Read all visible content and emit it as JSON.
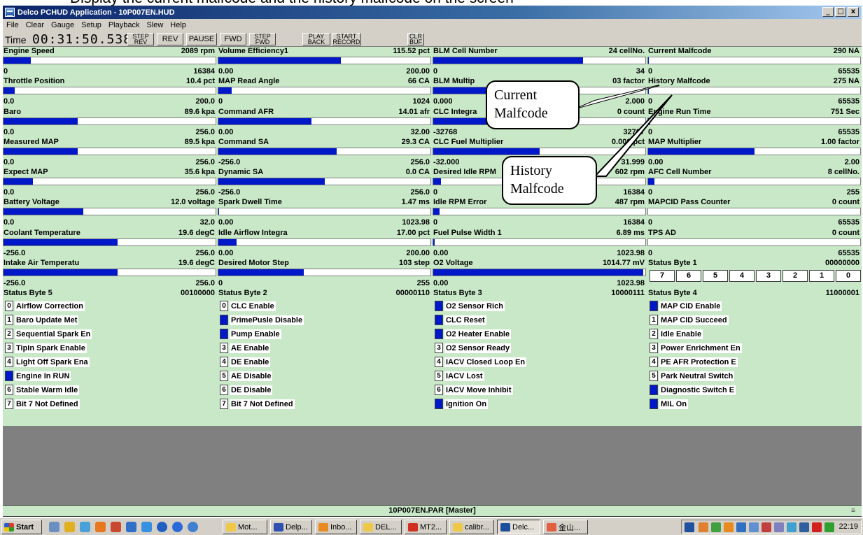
{
  "caption": "Display the current malfcode and the history malfcode on the screen",
  "window": {
    "title": "Delco PCHUD Application - 10P007EN.HUD",
    "buttons": [
      "_",
      "□",
      "x"
    ]
  },
  "menu": [
    "File",
    "Clear",
    "Gauge",
    "Setup",
    "Playback",
    "Slew",
    "Help"
  ],
  "toolbar": {
    "time_label": "Time",
    "time_value": "00:31:50.538",
    "step_rev": [
      "STEP",
      "REV"
    ],
    "rev": "REV",
    "pause": "PAUSE",
    "fwd": "FWD",
    "step_fwd": [
      "STEP",
      "FWD"
    ],
    "play_back": [
      "PLAY",
      "BACK"
    ],
    "start_record": [
      "START",
      "RECORD"
    ],
    "clr_buf": [
      "CLR",
      "BUF"
    ]
  },
  "gauges": [
    [
      {
        "name": "Engine Speed",
        "value": "2089 rpm",
        "min": "0",
        "max": "16384",
        "fill": 0.128
      },
      {
        "name": "Throttle Position",
        "value": "10.4 pct",
        "min": "0.0",
        "max": "200.0",
        "fill": 0.052
      },
      {
        "name": "Baro",
        "value": "89.6 kpa",
        "min": "0.0",
        "max": "256.0",
        "fill": 0.35
      },
      {
        "name": "Measured MAP",
        "value": "89.5 kpa",
        "min": "0.0",
        "max": "256.0",
        "fill": 0.35
      },
      {
        "name": "Expect MAP",
        "value": "35.6 kpa",
        "min": "0.0",
        "max": "256.0",
        "fill": 0.139
      },
      {
        "name": "Battery Voltage",
        "value": "12.0 voltage",
        "min": "0.0",
        "max": "32.0",
        "fill": 0.375
      },
      {
        "name": "Coolant Temperature",
        "value": "19.6 degC",
        "min": "-256.0",
        "max": "256.0",
        "fill": 0.538
      },
      {
        "name": "Intake Air Temperatu",
        "value": "19.6 degC",
        "min": "-256.0",
        "max": "256.0",
        "fill": 0.538
      }
    ],
    [
      {
        "name": "Volume Efficiency1",
        "value": "115.52 pct",
        "min": "0.00",
        "max": "200.00",
        "fill": 0.578
      },
      {
        "name": "MAP Read Angle",
        "value": "66 CA",
        "min": "0",
        "max": "1024",
        "fill": 0.064
      },
      {
        "name": "Command AFR",
        "value": "14.01 afr",
        "min": "0.00",
        "max": "32.00",
        "fill": 0.438
      },
      {
        "name": "Command SA",
        "value": "29.3 CA",
        "min": "-256.0",
        "max": "256.0",
        "fill": 0.557
      },
      {
        "name": "Dynamic SA",
        "value": "0.0 CA",
        "min": "-256.0",
        "max": "256.0",
        "fill": 0.5
      },
      {
        "name": "Spark Dwell Time",
        "value": "1.47 ms",
        "min": "0.00",
        "max": "1023.98",
        "fill": 0.0015
      },
      {
        "name": "Idle Airflow Integra",
        "value": "17.00 pct",
        "min": "0.00",
        "max": "200.00",
        "fill": 0.085
      },
      {
        "name": "Desired Motor Step",
        "value": "103 step",
        "min": "0",
        "max": "255",
        "fill": 0.404
      }
    ],
    [
      {
        "name": "BLM Cell Number",
        "value": "24 cellNo.",
        "min": "0",
        "max": "34",
        "fill": 0.706
      },
      {
        "name": "BLM Multip",
        "value": "03 factor",
        "min": "0.000",
        "max": "2.000",
        "fill": 0.5
      },
      {
        "name": "CLC Integra",
        "value": "0 count",
        "min": "-32768",
        "max": "32767",
        "fill": 0.5
      },
      {
        "name": "CLC Fuel Multiplier",
        "value": "0.000 pct",
        "min": "-32.000",
        "max": "31.999",
        "fill": 0.5
      },
      {
        "name": "Desired Idle RPM",
        "value": "602 rpm",
        "min": "0",
        "max": "16384",
        "fill": 0.037
      },
      {
        "name": "Idle RPM Error",
        "value": "487 rpm",
        "min": "0",
        "max": "16384",
        "fill": 0.03
      },
      {
        "name": "Fuel Pulse Width 1",
        "value": "6.89 ms",
        "min": "0.00",
        "max": "1023.98",
        "fill": 0.007
      },
      {
        "name": "O2 Voltage",
        "value": "1014.77 mV",
        "min": "0.00",
        "max": "1023.98",
        "fill": 0.991
      }
    ],
    [
      {
        "name": "Current Malfcode",
        "value": "290 NA",
        "min": "0",
        "max": "65535",
        "fill": 0.004
      },
      {
        "name": "History Malfcode",
        "value": "275 NA",
        "min": "0",
        "max": "65535",
        "fill": 0.004
      },
      {
        "name": "Engine Run Time",
        "value": "751 Sec",
        "min": "0",
        "max": "65535",
        "fill": 0.011
      },
      {
        "name": "MAP Multiplier",
        "value": "1.00 factor",
        "min": "0.00",
        "max": "2.00",
        "fill": 0.5
      },
      {
        "name": "AFC Cell Number",
        "value": "8 cellNo.",
        "min": "0",
        "max": "255",
        "fill": 0.031
      },
      {
        "name": "MAPCID Pass Counter",
        "value": "0 count",
        "min": "0",
        "max": "65535",
        "fill": 0
      },
      {
        "name": "TPS AD",
        "value": "0 count",
        "min": "0",
        "max": "65535",
        "fill": 0
      }
    ]
  ],
  "status_byte_1": {
    "label": "Status Byte 1",
    "value": "00000000",
    "bits": [
      "7",
      "6",
      "5",
      "4",
      "3",
      "2",
      "1",
      "0"
    ]
  },
  "status_blocks": [
    {
      "label": "Status Byte 5",
      "value": "00100000",
      "bits": [
        {
          "n": "0",
          "label": "Airflow Correction",
          "on": false
        },
        {
          "n": "1",
          "label": "Baro Update Met",
          "on": false
        },
        {
          "n": "2",
          "label": "Sequential Spark En",
          "on": false
        },
        {
          "n": "3",
          "label": "TipIn Spark Enable",
          "on": false
        },
        {
          "n": "4",
          "label": "Light Off Spark Ena",
          "on": false
        },
        {
          "n": "5",
          "label": "Engine In RUN",
          "on": true
        },
        {
          "n": "6",
          "label": "Stable Warm Idle",
          "on": false
        },
        {
          "n": "7",
          "label": "Bit 7 Not Defined",
          "on": false
        }
      ]
    },
    {
      "label": "Status Byte 2",
      "value": "00000110",
      "bits": [
        {
          "n": "0",
          "label": "CLC Enable",
          "on": false
        },
        {
          "n": "1",
          "label": "PrimePusle Disable",
          "on": true
        },
        {
          "n": "2",
          "label": "Pump Enable",
          "on": true
        },
        {
          "n": "3",
          "label": "AE Enable",
          "on": false
        },
        {
          "n": "4",
          "label": "DE Enable",
          "on": false
        },
        {
          "n": "5",
          "label": "AE Disable",
          "on": false
        },
        {
          "n": "6",
          "label": "DE Disable",
          "on": false
        },
        {
          "n": "7",
          "label": "Bit 7 Not Defined",
          "on": false
        }
      ]
    },
    {
      "label": "Status Byte 3",
      "value": "10000111",
      "bits": [
        {
          "n": "0",
          "label": "O2 Sensor Rich",
          "on": true
        },
        {
          "n": "1",
          "label": "CLC Reset",
          "on": true
        },
        {
          "n": "2",
          "label": "O2 Heater Enable",
          "on": true
        },
        {
          "n": "3",
          "label": "O2 Sensor Ready",
          "on": false
        },
        {
          "n": "4",
          "label": "IACV Closed Loop En",
          "on": false
        },
        {
          "n": "5",
          "label": "IACV Lost",
          "on": false
        },
        {
          "n": "6",
          "label": "IACV Move Inhibit",
          "on": false
        },
        {
          "n": "7",
          "label": "Ignition On",
          "on": true
        }
      ]
    },
    {
      "label": "Status Byte 4",
      "value": "11000001",
      "bits": [
        {
          "n": "0",
          "label": "MAP CID Enable",
          "on": true
        },
        {
          "n": "1",
          "label": "MAP CID Succeed",
          "on": false
        },
        {
          "n": "2",
          "label": "Idle Enable",
          "on": false
        },
        {
          "n": "3",
          "label": "Power Enrichment En",
          "on": false
        },
        {
          "n": "4",
          "label": "PE AFR Protection E",
          "on": false
        },
        {
          "n": "5",
          "label": "Park Neutral Switch",
          "on": false
        },
        {
          "n": "6",
          "label": "Diagnostic Switch E",
          "on": true
        },
        {
          "n": "7",
          "label": "MIL On",
          "on": true
        }
      ]
    }
  ],
  "callouts": {
    "current": [
      "Current",
      "Malfcode"
    ],
    "history": [
      "History",
      "Malfcode"
    ]
  },
  "statusbar": "10P007EN.PAR [Master]",
  "taskbar": {
    "start": "Start",
    "tasks": [
      "Mot...",
      "Delp...",
      "Inbo...",
      "DEL...",
      "MT2...",
      "calibr...",
      "Delc...",
      "金山..."
    ],
    "clock": "22:19"
  },
  "colors": {
    "panel": "#c8e8c8",
    "bar_fill": "#0018c8",
    "title_start": "#0a246a",
    "chrome": "#d4d0c8"
  }
}
